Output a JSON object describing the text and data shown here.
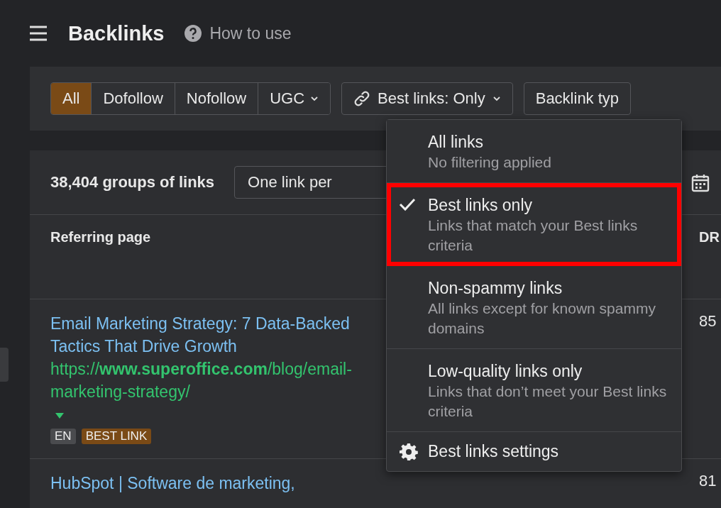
{
  "header": {
    "title": "Backlinks",
    "help_link": "How to use"
  },
  "filters": {
    "link_types": [
      {
        "label": "All",
        "selected": true,
        "caret": false
      },
      {
        "label": "Dofollow",
        "selected": false,
        "caret": false
      },
      {
        "label": "Nofollow",
        "selected": false,
        "caret": false
      },
      {
        "label": "UGC",
        "selected": false,
        "caret": true
      }
    ],
    "best_links_button": "Best links: Only",
    "backlink_type_button": "Backlink typ"
  },
  "best_links_menu": [
    {
      "kind": "option",
      "title": "All links",
      "description": "No filtering applied",
      "selected": false,
      "highlighted": false
    },
    {
      "kind": "option",
      "title": "Best links only",
      "description": "Links that match your Best links criteria",
      "selected": true,
      "highlighted": true
    },
    {
      "kind": "option",
      "title": "Non-spammy links",
      "description": "All links except for known spammy domains",
      "selected": false,
      "highlighted": false
    },
    {
      "kind": "option",
      "title": "Low-quality links only",
      "description": "Links that don’t meet your Best links criteria",
      "selected": false,
      "highlighted": false
    },
    {
      "kind": "settings",
      "title": "Best links settings"
    }
  ],
  "table": {
    "summary": "38,404 groups of links",
    "grouping_dropdown": "One link per",
    "columns": [
      "Referring page",
      "DR"
    ],
    "rows": [
      {
        "title": "Email Marketing Strategy: 7 Data-Backed Tactics That Drive Growth",
        "url": "https://**www.superoffice.com**/blog/email-marketing-strategy/",
        "tags": [
          {
            "label": "EN",
            "kind": "lang"
          },
          {
            "label": "BEST LINK",
            "kind": "best"
          }
        ],
        "dr": "85"
      },
      {
        "title": "HubSpot | Software de marketing,",
        "dr": "81"
      }
    ]
  }
}
